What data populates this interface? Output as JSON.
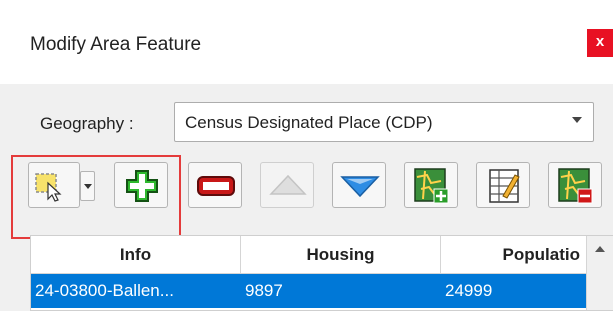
{
  "dialog": {
    "title": "Modify Area Feature",
    "close_label": "x"
  },
  "geography": {
    "label": "Geography :",
    "selected": "Census Designated Place (CDP)"
  },
  "toolbar": {
    "buttons": [
      {
        "icon": "select-area-icon",
        "enabled": true
      },
      {
        "icon": "add-icon",
        "enabled": true
      },
      {
        "icon": "remove-icon",
        "enabled": true
      },
      {
        "icon": "move-up-icon",
        "enabled": false
      },
      {
        "icon": "move-down-icon",
        "enabled": true
      },
      {
        "icon": "add-map-layer-icon",
        "enabled": true
      },
      {
        "icon": "edit-attributes-icon",
        "enabled": true
      },
      {
        "icon": "remove-map-layer-icon",
        "enabled": true
      }
    ]
  },
  "table": {
    "columns": [
      "Info",
      "Housing",
      "Populatio"
    ],
    "rows": [
      {
        "info": "24-03800-Ballen...",
        "housing": "9897",
        "population": "24999"
      }
    ]
  },
  "colors": {
    "selection": "#0078d7",
    "highlight": "#e43b3b",
    "close": "#e81123"
  }
}
